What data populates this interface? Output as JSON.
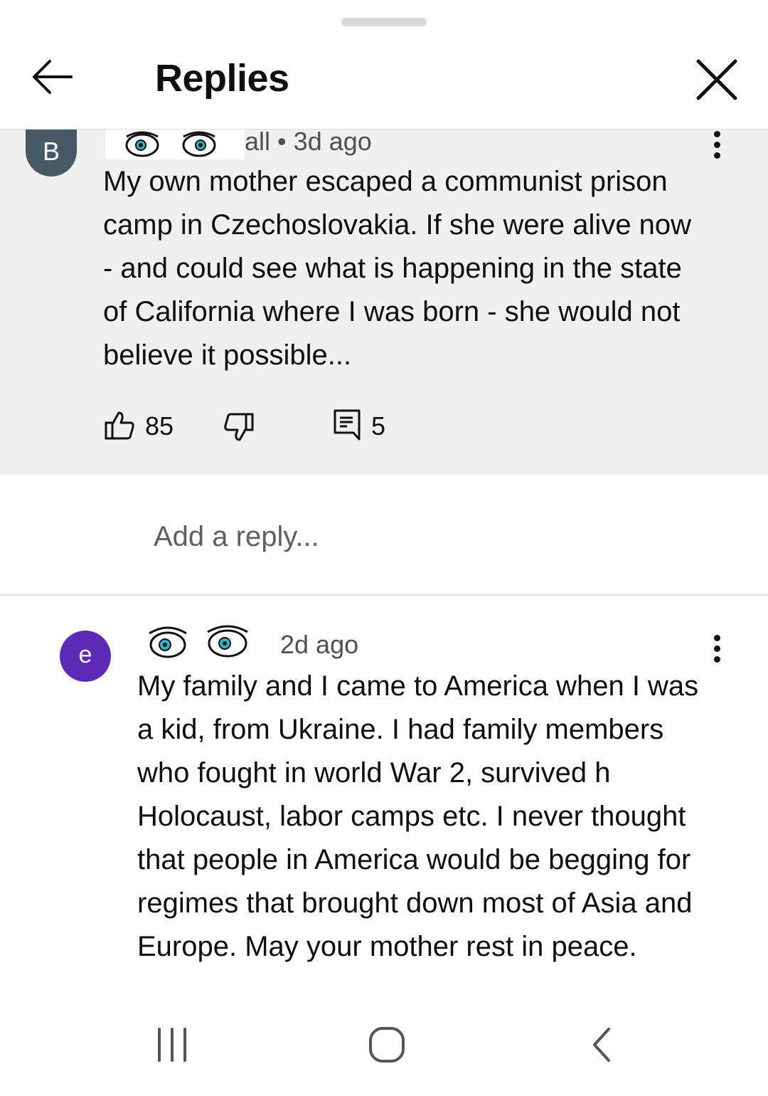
{
  "header": {
    "title": "Replies"
  },
  "parent_comment": {
    "avatar_letter": "B",
    "author_partial": "all",
    "separator": "•",
    "time": "3d ago",
    "lines": [
      "My own mother escaped a communist prison",
      "camp in Czechoslovakia. If she were alive now",
      "- and could see what is happening in the state",
      "of California where I was born - she would not",
      "believe it possible..."
    ],
    "likes": "85",
    "replies": "5"
  },
  "reply_input": {
    "placeholder": "Add a reply..."
  },
  "reply": {
    "avatar_letter": "e",
    "time": "2d ago",
    "lines": [
      "My family and I came to America when I was",
      "a kid, from Ukraine. I had family members",
      "who fought in world War 2, survived h",
      "Holocaust, labor camps etc. I never thought",
      "that people in America would be begging for",
      "regimes that brought down most of Asia and",
      "Europe. May your mother rest in peace."
    ]
  },
  "icons": {
    "back": "arrow-left-icon",
    "close": "close-icon",
    "more": "more-vert-icon",
    "like": "thumb-up-icon",
    "dislike": "thumb-down-icon",
    "reply": "comment-icon",
    "nav_recents": "recents-icon",
    "nav_home": "home-icon",
    "nav_back": "nav-back-icon"
  },
  "colors": {
    "parent_background": "#f0f0f0",
    "avatar_b": "#455a64",
    "avatar_e": "#5b2bb8"
  }
}
